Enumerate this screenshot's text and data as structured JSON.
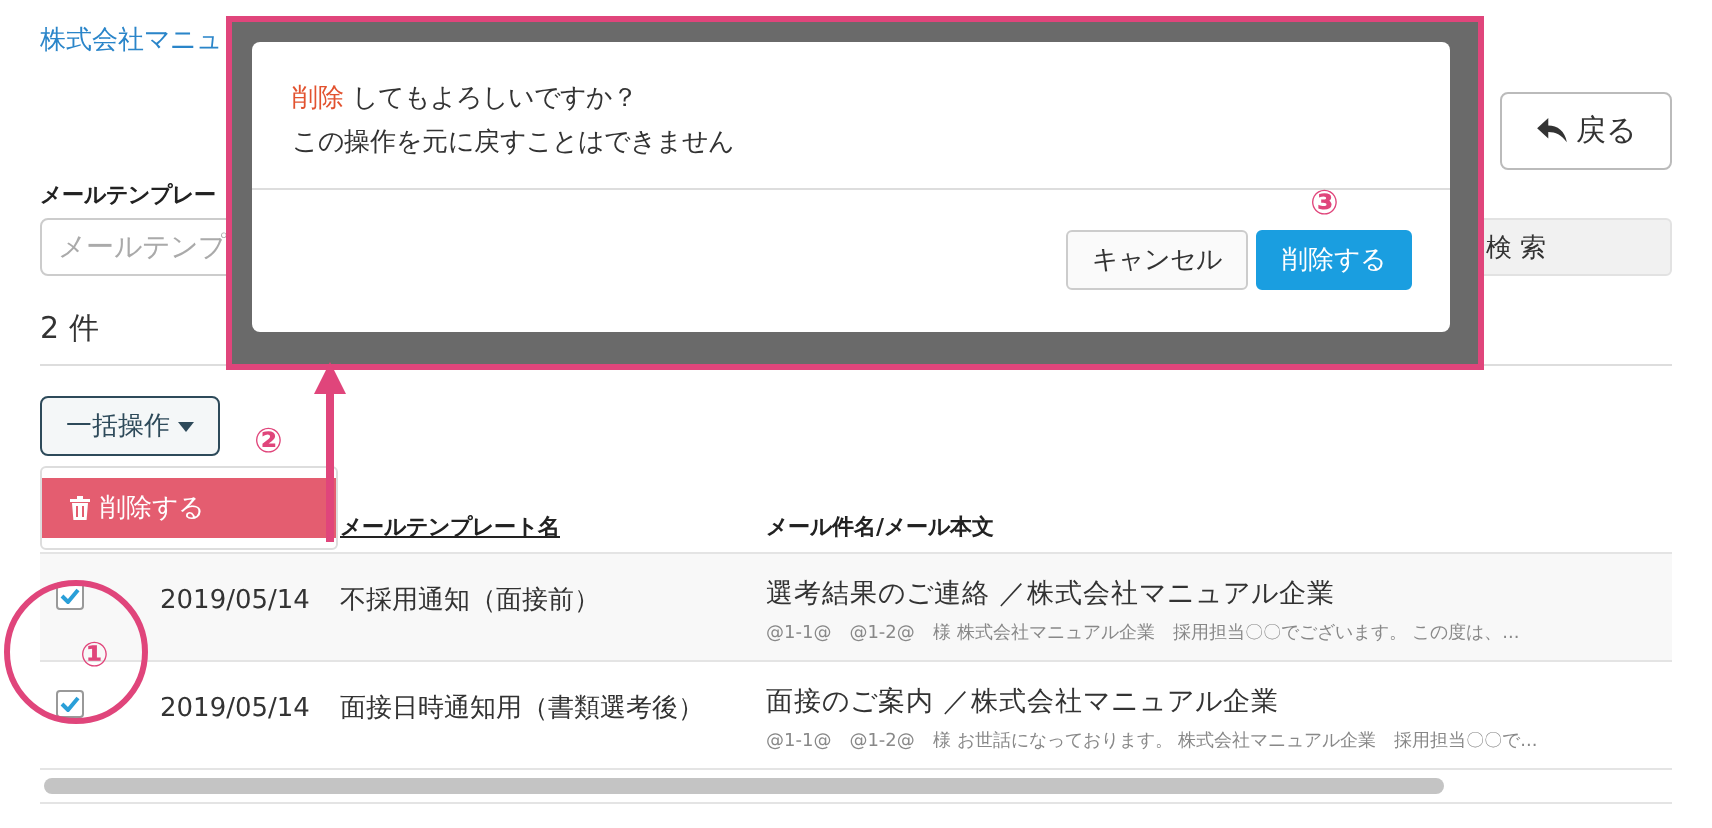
{
  "breadcrumb": "株式会社マニュ",
  "back_button": {
    "label": "戻る"
  },
  "search": {
    "label": "メールテンプレー",
    "placeholder": "メールテンプ",
    "button": "検 索"
  },
  "count": "2 件",
  "bulk_menu": {
    "label": "一括操作",
    "expanded": true,
    "items": [
      {
        "label": "削除する",
        "selected": true
      }
    ]
  },
  "table": {
    "columns": [
      {
        "label": "メールテンプレート名",
        "sortable": true
      },
      {
        "label": "メール件名/メール本文",
        "sortable": false
      }
    ],
    "rows": [
      {
        "checked": true,
        "date": "2019/05/14",
        "name": "不採用通知（面接前）",
        "subject": "選考結果のご連絡 ／株式会社マニュアル企業",
        "body": "@1-1@　@1-2@　様 株式会社マニュアル企業　採用担当〇〇でございます。 この度は、..."
      },
      {
        "checked": true,
        "date": "2019/05/14",
        "name": "面接日時通知用（書類選考後）",
        "subject": "面接のご案内 ／株式会社マニュアル企業",
        "body": "@1-1@　@1-2@　様 お世話になっております。 株式会社マニュアル企業　採用担当〇〇で..."
      }
    ]
  },
  "dialog": {
    "highlight": "削除",
    "line1": "してもよろしいですか？",
    "line2": "この操作を元に戻すことはできません",
    "buttons": [
      {
        "label": "キャンセル",
        "kind": "default"
      },
      {
        "label": "削除する",
        "kind": "primary"
      }
    ]
  },
  "annotations": [
    {
      "kind": "circle",
      "label": "①"
    },
    {
      "kind": "arrow",
      "label": "②"
    },
    {
      "kind": "marker",
      "label": "③"
    }
  ]
}
